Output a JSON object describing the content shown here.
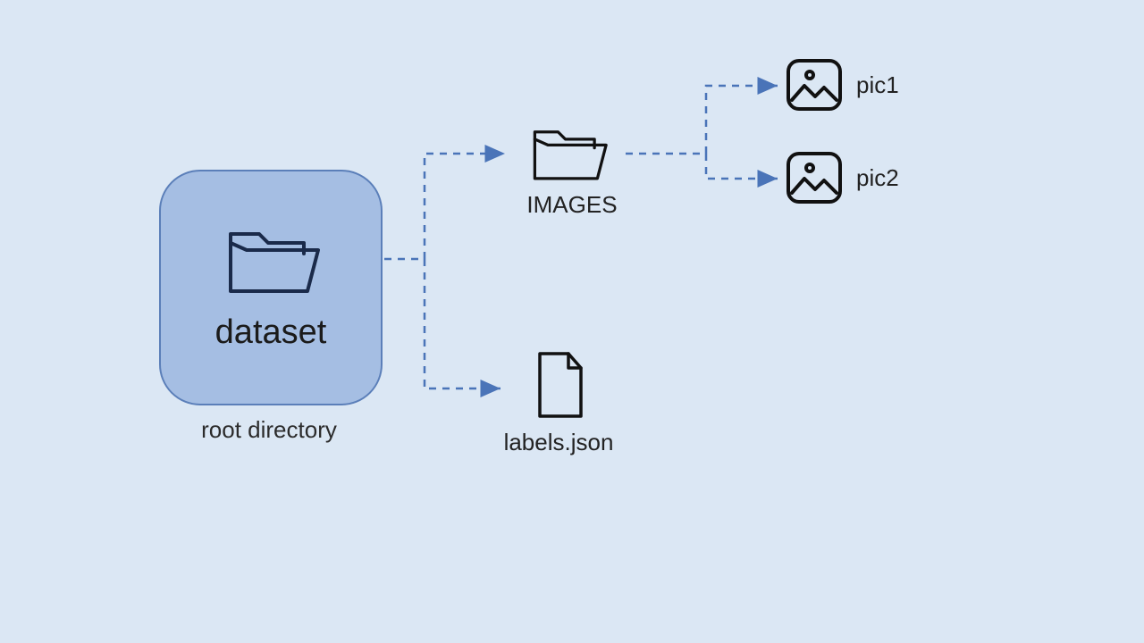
{
  "diagram": {
    "root": {
      "name": "dataset",
      "caption": "root directory"
    },
    "children": {
      "images_folder": {
        "label": "IMAGES",
        "files": [
          "pic1",
          "pic2"
        ]
      },
      "labels_file": {
        "label": "labels.json"
      }
    }
  },
  "colors": {
    "bg": "#dbe7f4",
    "root_fill": "#a5bee3",
    "root_stroke": "#5b7fb9",
    "arrow": "#4a74b8",
    "icon_stroke": "#111"
  }
}
